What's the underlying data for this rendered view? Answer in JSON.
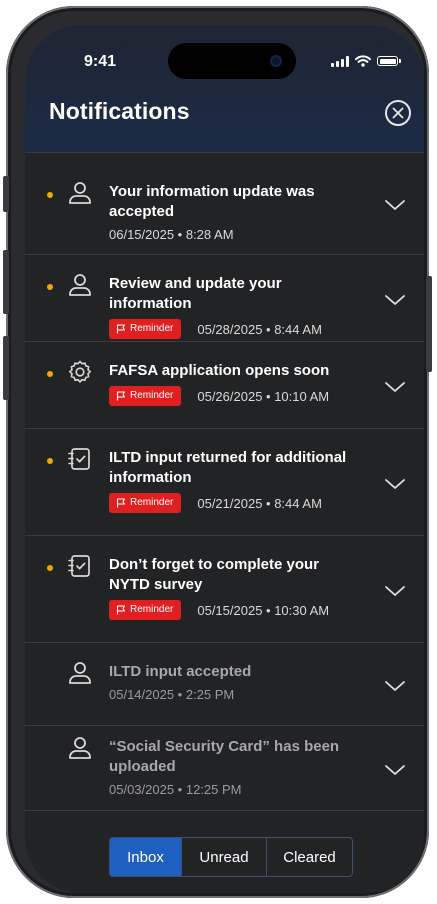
{
  "status": {
    "time": "9:41"
  },
  "header": {
    "title": "Notifications"
  },
  "notifications": [
    {
      "title": "Your information update was accepted",
      "date": "06/15/2025 • 8:28 AM",
      "icon": "person-icon",
      "unread": true,
      "reminder": false
    },
    {
      "title": "Review and update your information",
      "date": "05/28/2025 • 8:44 AM",
      "icon": "person-icon",
      "unread": true,
      "reminder": true
    },
    {
      "title": "FAFSA application opens soon",
      "date": "05/26/2025 • 10:10 AM",
      "icon": "gear-icon",
      "unread": true,
      "reminder": true
    },
    {
      "title": "ILTD input returned for additional information",
      "date": "05/21/2025 • 8:44 AM",
      "icon": "checklist-icon",
      "unread": true,
      "reminder": true
    },
    {
      "title": "Don’t forget to complete your NYTD survey",
      "date": "05/15/2025 • 10:30 AM",
      "icon": "checklist-icon",
      "unread": true,
      "reminder": true
    },
    {
      "title": "ILTD input accepted",
      "date": "05/14/2025 • 2:25 PM",
      "icon": "person-icon",
      "unread": false,
      "reminder": false
    },
    {
      "title": "“Social Security Card” has been uploaded",
      "date": "05/03/2025 • 12:25 PM",
      "icon": "person-icon",
      "unread": false,
      "reminder": false
    }
  ],
  "reminder_label": "Reminder",
  "tabs": [
    {
      "label": "Inbox",
      "active": true
    },
    {
      "label": "Unread",
      "active": false
    },
    {
      "label": "Cleared",
      "active": false
    }
  ],
  "colors": {
    "accent": "#1f5fbf",
    "unread_dot": "#f2a60d",
    "reminder": "#e02020",
    "background": "#222325"
  }
}
